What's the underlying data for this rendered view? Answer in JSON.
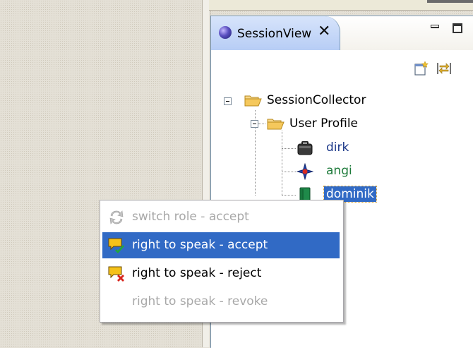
{
  "view": {
    "tab_title": "SessionView",
    "close_glyph": "✕",
    "toolbar": [
      {
        "icon": "new-session-icon"
      },
      {
        "icon": "sync-icon"
      }
    ]
  },
  "tree": {
    "root": {
      "label": "SessionCollector",
      "expanded": true
    },
    "group": {
      "label": "User Profile",
      "expanded": true
    },
    "users": [
      {
        "label": "dirk",
        "color": "#1e3a8a",
        "icon": "briefcase-icon"
      },
      {
        "label": "angi",
        "color": "#1d7a3a",
        "icon": "compass-icon"
      },
      {
        "label": "dominik",
        "color": "#ffffff",
        "icon": "book-icon",
        "selected": true
      }
    ]
  },
  "context_menu": {
    "items": [
      {
        "label": "switch role - accept",
        "icon": "switch-role-icon",
        "enabled": false,
        "highlighted": false
      },
      {
        "label": "right to speak - accept",
        "icon": "speech-accept-icon",
        "enabled": true,
        "highlighted": true
      },
      {
        "label": "right to speak - reject",
        "icon": "speech-reject-icon",
        "enabled": true,
        "highlighted": false
      },
      {
        "label": "right to speak - revoke",
        "icon": "",
        "enabled": false,
        "highlighted": false
      }
    ]
  },
  "colors": {
    "selection": "#316ac5",
    "tab_gradient_top": "#d7e4fb",
    "tab_gradient_bottom": "#b7cdf5",
    "dirk_label": "#1e3a8a",
    "angi_label": "#1d7a3a"
  }
}
